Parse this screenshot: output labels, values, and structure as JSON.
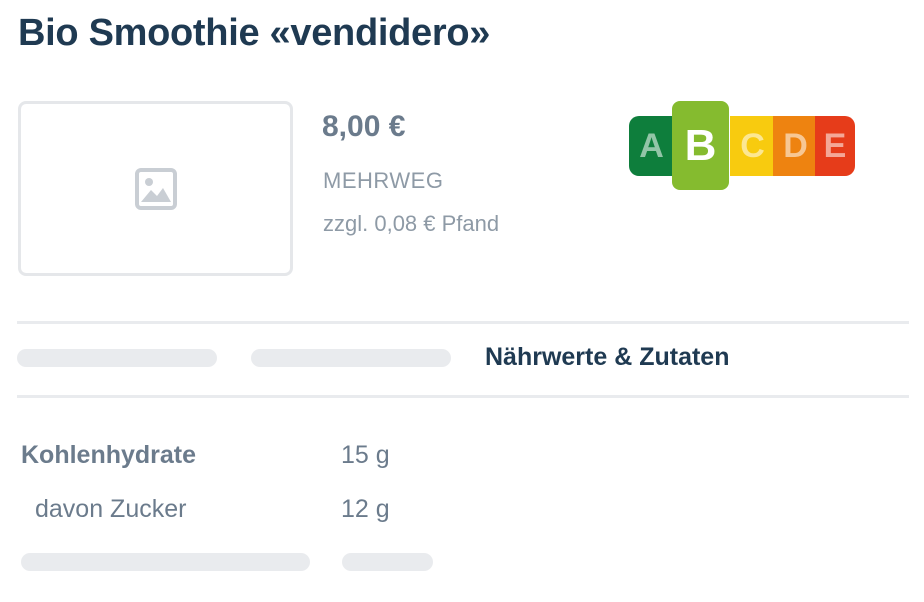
{
  "product": {
    "title": "Bio Smoothie «vendidero»",
    "price": "8,00 €",
    "deposit_type": "MEHRWEG",
    "deposit_amount": "zzgl. 0,08 € Pfand",
    "image_icon": "image-placeholder-icon"
  },
  "nutriscore": {
    "grades": [
      "A",
      "B",
      "C",
      "D",
      "E"
    ],
    "selected": "B",
    "colors": {
      "A": "#0e7e3c",
      "B": "#85bb2f",
      "C": "#f8cb0f",
      "D": "#ee8310",
      "E": "#e63c1a"
    }
  },
  "tabs": {
    "active_label": "Nährwerte & Zutaten"
  },
  "nutrition": {
    "rows": [
      {
        "label": "Kohlenhydrate",
        "value": "15 g"
      },
      {
        "label": "davon Zucker",
        "value": "12 g"
      }
    ]
  }
}
